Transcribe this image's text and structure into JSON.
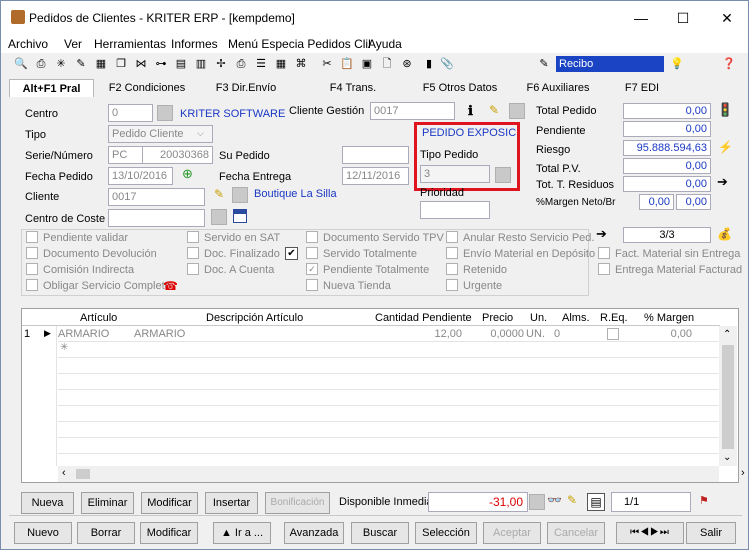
{
  "window": {
    "title": "Pedidos de Clientes - KRITER ERP - [kempdemo]",
    "minimize": "—",
    "maximize": "☐",
    "close": "✕"
  },
  "menu": [
    "Archivo",
    "Ver",
    "Herramientas",
    "Informes",
    "Menú Especia Pedidos Clil",
    "Ayuda"
  ],
  "toolbar": {
    "recibo": "Recibo"
  },
  "tabs": [
    "Alt+F1 Pral",
    "F2 Condiciones",
    "F3 Dir.Envío",
    "F4 Trans.",
    "F5 Otros Datos",
    "F6 Auxiliares",
    "F7 EDI"
  ],
  "form": {
    "centro_label": "Centro",
    "centro_value": "0",
    "centro_name": "KRITER SOFTWARE",
    "cliente_gestion_label": "Cliente Gestión",
    "cliente_gestion_value": "0017",
    "tipo_label": "Tipo",
    "tipo_value": "Pedido Cliente",
    "serie_label": "Serie/Número",
    "serie_value": "PC",
    "numero_value": "20030368",
    "su_pedido_label": "Su Pedido",
    "fecha_pedido_label": "Fecha Pedido",
    "fecha_pedido_value": "13/10/2016",
    "fecha_entrega_label": "Fecha Entrega",
    "fecha_entrega_value": "12/11/2016",
    "cliente_label": "Cliente",
    "cliente_value": "0017",
    "cliente_name": "Boutique La Silla",
    "centro_coste_label": "Centro de Coste",
    "pedido_exposic": "PEDIDO EXPOSIC",
    "tipo_pedido_label": "Tipo Pedido",
    "tipo_pedido_value": "3",
    "prioridad_label": "Prioridad"
  },
  "totals": {
    "total_pedido_label": "Total Pedido",
    "total_pedido": "0,00",
    "pendiente_label": "Pendiente",
    "pendiente": "0,00",
    "riesgo_label": "Riesgo",
    "riesgo": "95.888.594,63",
    "total_pv_label": "Total P.V.",
    "total_pv": "0,00",
    "tot_residuos_label": "Tot. T. Residuos",
    "tot_residuos": "0,00",
    "margen_label": "%Margen Neto/Br",
    "margen_neto": "0,00",
    "margen_bruto": "0,00",
    "pager": "3/3"
  },
  "checks": {
    "col1": [
      "Pendiente validar",
      "Documento Devolución",
      "Comisión Indirecta",
      "Obligar Servicio Completo"
    ],
    "col2": [
      "Servido en SAT",
      "Doc. Finalizado",
      "Doc. A Cuenta"
    ],
    "col3": [
      "Documento Servido TPV",
      "Servido Totalmente",
      "Pendiente Totalmente",
      "Nueva Tienda"
    ],
    "col4": [
      "Anular Resto Servicio Ped.",
      "Envío Material en Depósito",
      "Retenido",
      "Urgente"
    ],
    "col5": [
      "Fact. Material sin Entrega",
      "Entrega Material Facturad"
    ]
  },
  "grid": {
    "headers": [
      "Artículo",
      "Descripción Artículo",
      "Cantidad Pendiente",
      "Precio",
      "Un.",
      "Alms.",
      "R.Eq.",
      "% Margen"
    ],
    "rows": [
      {
        "num": "1",
        "articulo": "ARMARIO",
        "descripcion": "ARMARIO",
        "cantidad": "12,00",
        "precio": "0,0000",
        "un": "UN.",
        "alms": "0",
        "margen": "0,00"
      }
    ]
  },
  "line_buttons": {
    "nueva": "Nueva",
    "eliminar": "Eliminar",
    "modificar": "Modificar",
    "insertar": "Insertar",
    "bonificacion": "Bonificación",
    "disponible_label": "Disponible Inmediato",
    "disponible_value": "-31,00",
    "pager": "1/1"
  },
  "bottom_buttons": {
    "nuevo": "Nuevo",
    "borrar": "Borrar",
    "modificar": "Modificar",
    "ira": "▲ Ir a ...",
    "avanzada": "Avanzada",
    "buscar": "Buscar",
    "seleccion": "Selección",
    "aceptar": "Aceptar",
    "cancelar": "Cancelar",
    "salir": "Salir"
  }
}
